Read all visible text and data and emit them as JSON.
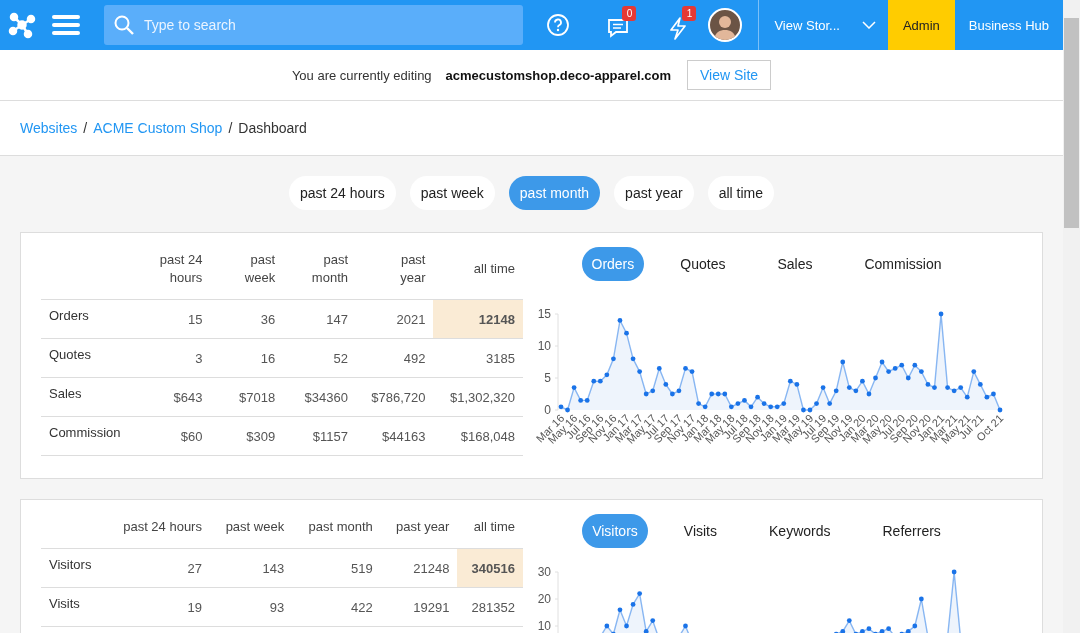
{
  "topbar": {
    "search": {
      "placeholder": "Type to search"
    },
    "messages_badge": "0",
    "alerts_badge": "1",
    "store_menu": "View Stor...",
    "admin": "Admin",
    "business_hub": "Business Hub"
  },
  "editing_bar": {
    "label": "You are currently editing",
    "domain": "acmecustomshop.deco-apparel.com",
    "button": "View Site"
  },
  "breadcrumb": [
    {
      "label": "Websites",
      "link": true
    },
    {
      "label": "ACME Custom Shop",
      "link": true
    },
    {
      "label": "Dashboard",
      "link": false
    }
  ],
  "breadcrumb_separator": "/",
  "periods": [
    {
      "label": "past 24 hours",
      "selected": false
    },
    {
      "label": "past week",
      "selected": false
    },
    {
      "label": "past month",
      "selected": true
    },
    {
      "label": "past year",
      "selected": false
    },
    {
      "label": "all time",
      "selected": false
    }
  ],
  "panels": [
    {
      "table": {
        "columns": [
          "past 24 hours",
          "past week",
          "past month",
          "past year",
          "all time"
        ],
        "rows": [
          {
            "label": "Orders",
            "cells": [
              {
                "text": "15",
                "highlighted": false
              },
              {
                "text": "36",
                "highlighted": false
              },
              {
                "text": "147",
                "highlighted": false
              },
              {
                "text": "2021",
                "highlighted": false
              },
              {
                "text": "12148",
                "highlighted": true
              }
            ]
          },
          {
            "label": "Quotes",
            "cells": [
              {
                "text": "3",
                "highlighted": false
              },
              {
                "text": "16",
                "highlighted": false
              },
              {
                "text": "52",
                "highlighted": false
              },
              {
                "text": "492",
                "highlighted": false
              },
              {
                "text": "3185",
                "highlighted": false
              }
            ]
          },
          {
            "label": "Sales",
            "cells": [
              {
                "text": "$643",
                "highlighted": false
              },
              {
                "text": "$7018",
                "highlighted": false
              },
              {
                "text": "$34360",
                "highlighted": false
              },
              {
                "text": "$786,720",
                "highlighted": false
              },
              {
                "text": "$1,302,320",
                "highlighted": false
              }
            ]
          },
          {
            "label": "Commission",
            "cells": [
              {
                "text": "$60",
                "highlighted": false
              },
              {
                "text": "$309",
                "highlighted": false
              },
              {
                "text": "$1157",
                "highlighted": false
              },
              {
                "text": "$44163",
                "highlighted": false
              },
              {
                "text": "$168,048",
                "highlighted": false
              }
            ]
          }
        ]
      },
      "chart_tabs": [
        {
          "label": "Orders",
          "selected": true
        },
        {
          "label": "Quotes",
          "selected": false
        },
        {
          "label": "Sales",
          "selected": false
        },
        {
          "label": "Commission",
          "selected": false
        }
      ],
      "chart_data": {
        "type": "area",
        "ylim": [
          0,
          15
        ],
        "yticks": [
          0,
          5,
          10,
          15
        ],
        "categories": [
          "Mar 16",
          null,
          "May 16",
          null,
          "Jul 16",
          null,
          "Sep 16",
          null,
          "Nov 16",
          null,
          "Jan 17",
          null,
          "Mar 17",
          null,
          "May 17",
          null,
          "Jul 17",
          null,
          "Sep 17",
          null,
          "Nov 17",
          null,
          "Jan 18",
          null,
          "Mar 18",
          null,
          "May 18",
          null,
          "Jul 18",
          null,
          "Sep 18",
          null,
          "Nov 18",
          null,
          "Jan 19",
          null,
          "Mar 19",
          null,
          "May 19",
          null,
          "Jul 19",
          null,
          "Sep 19",
          null,
          "Nov 19",
          null,
          "Jan 20",
          null,
          "Mar 20",
          null,
          "May 20",
          null,
          "Jul 20",
          null,
          "Sep 20",
          null,
          "Nov 20",
          null,
          "Jan 21",
          null,
          "Mar 21",
          null,
          "May 21",
          null,
          "Jul 21",
          null,
          null,
          "Oct 21"
        ],
        "series": [
          {
            "color": "#1a73e8",
            "values": [
              0.5,
              0,
              3.5,
              1.5,
              1.5,
              4.5,
              4.5,
              5.5,
              8,
              14,
              12,
              8,
              6,
              2.5,
              3,
              6.5,
              4,
              2.5,
              3,
              6.5,
              6,
              1,
              0.5,
              2.5,
              2.5,
              2.5,
              0.5,
              1,
              1.5,
              0.5,
              2,
              1,
              0.5,
              0.5,
              1,
              4.5,
              4,
              0,
              0,
              1,
              3.5,
              1,
              3,
              7.5,
              3.5,
              3,
              4.5,
              2.5,
              5,
              7.5,
              6,
              6.5,
              7,
              5,
              7,
              6,
              4,
              3.5,
              15,
              3.5,
              3,
              3.5,
              2,
              6,
              4,
              2,
              2.5,
              0
            ]
          }
        ]
      }
    },
    {
      "table": {
        "columns": [
          "past 24 hours",
          "past week",
          "past month",
          "past year",
          "all time"
        ],
        "rows": [
          {
            "label": "Visitors",
            "cells": [
              {
                "text": "27",
                "highlighted": false
              },
              {
                "text": "143",
                "highlighted": false
              },
              {
                "text": "519",
                "highlighted": false
              },
              {
                "text": "21248",
                "highlighted": false
              },
              {
                "text": "340516",
                "highlighted": true
              }
            ]
          },
          {
            "label": "Visits",
            "cells": [
              {
                "text": "19",
                "highlighted": false
              },
              {
                "text": "93",
                "highlighted": false
              },
              {
                "text": "422",
                "highlighted": false
              },
              {
                "text": "19291",
                "highlighted": false
              },
              {
                "text": "281352",
                "highlighted": false
              }
            ]
          }
        ]
      },
      "chart_tabs": [
        {
          "label": "Visitors",
          "selected": true
        },
        {
          "label": "Visits",
          "selected": false
        },
        {
          "label": "Keywords",
          "selected": false
        },
        {
          "label": "Referrers",
          "selected": false
        }
      ],
      "chart_data": {
        "type": "area",
        "ylim": [
          0,
          30
        ],
        "yticks": [
          10,
          20,
          30
        ],
        "series": [
          {
            "color": "#1a73e8",
            "values": [
              2,
              3,
              2,
              4,
              3,
              5,
              6,
              10,
              7,
              16,
              10,
              18,
              22,
              8,
              12,
              5,
              4,
              3,
              6,
              10,
              4,
              3,
              2,
              3,
              4,
              2,
              3,
              4,
              3,
              2,
              3,
              4,
              3,
              2,
              3,
              4,
              5,
              3,
              2,
              4,
              5,
              6,
              7,
              8,
              12,
              7,
              8,
              9,
              7,
              8,
              9,
              6,
              7,
              8,
              10,
              20,
              6,
              5,
              4,
              6,
              30,
              5,
              4,
              6,
              5,
              4,
              3,
              2
            ]
          }
        ]
      }
    }
  ]
}
